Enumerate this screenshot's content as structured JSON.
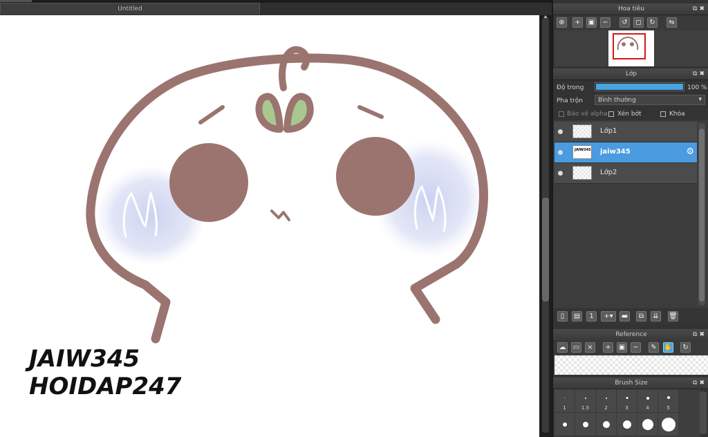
{
  "window": {
    "doc_tab_title": "Untitled"
  },
  "canvas": {
    "caption_line1": "JAIW345",
    "caption_line2": "HOIDAP247"
  },
  "navigator": {
    "title": "Hoa tiêu",
    "controls": "⧉✖"
  },
  "layers": {
    "title": "Lớp",
    "controls": "⧉✖",
    "opacity_label": "Độ trong",
    "opacity_value": "100 %",
    "opacity_fraction": 1.0,
    "blend_label": "Pha trộn",
    "blend_value": "Bình thường",
    "protect_alpha_label": "Bảo vệ alpha",
    "clipping_label": "Xén bớt",
    "lock_label": "Khóa",
    "items": [
      {
        "name": "Lớp1",
        "selected": false
      },
      {
        "name": "jaiw345",
        "selected": true
      },
      {
        "name": "Lớp2",
        "selected": false
      }
    ]
  },
  "reference": {
    "title": "Reference",
    "controls": "⧉✖"
  },
  "brush_size": {
    "title": "Brush Size",
    "controls": "⧉✖",
    "sizes": [
      "1",
      "1.5",
      "2",
      "3",
      "4",
      "5"
    ]
  },
  "colors": {
    "accent": "#4a9be0",
    "face_stroke": "#9b7470",
    "blush": "#c8d0ee",
    "leaf": "#a8c890"
  }
}
